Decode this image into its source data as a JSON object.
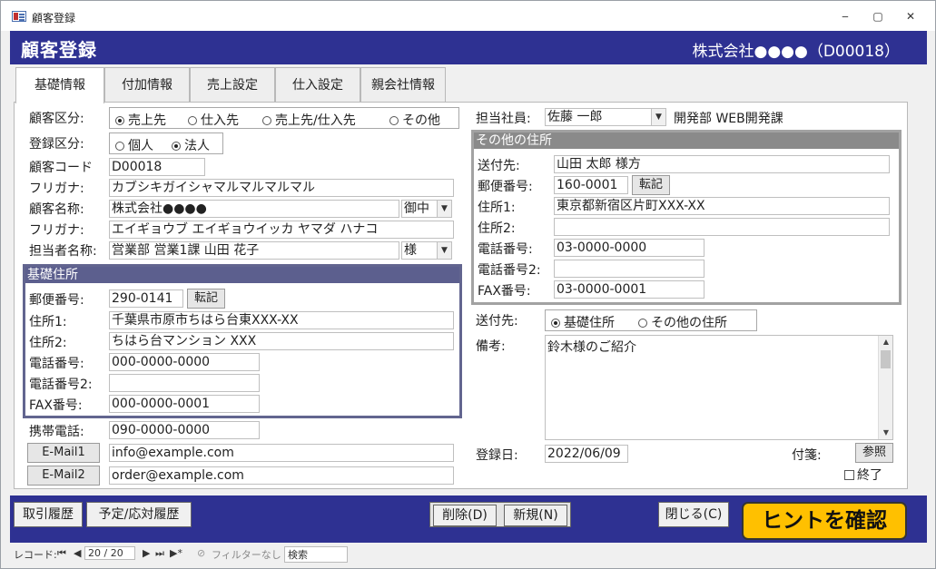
{
  "window": {
    "title": "顧客登録",
    "min": "‒",
    "max": "▢",
    "close": "✕"
  },
  "header": {
    "title": "顧客登録",
    "company": "株式会社●●●●（D00018）"
  },
  "tabs": [
    "基礎情報",
    "付加情報",
    "売上設定",
    "仕入設定",
    "親会社情報"
  ],
  "left": {
    "customer_type": {
      "label": "顧客区分:",
      "options": [
        "売上先",
        "仕入先",
        "売上先/仕入先",
        "その他"
      ],
      "selected": "売上先"
    },
    "reg_type": {
      "label": "登録区分:",
      "options": [
        "個人",
        "法人"
      ],
      "selected": "法人"
    },
    "customer_code": {
      "label": "顧客コード",
      "value": "D00018"
    },
    "furigana1": {
      "label": "フリガナ:",
      "value": "カブシキガイシャマルマルマルマル"
    },
    "customer_name": {
      "label": "顧客名称:",
      "value": "株式会社●●●●",
      "honorific": "御中"
    },
    "furigana2": {
      "label": "フリガナ:",
      "value": "エイギョウブ エイギョウイッカ ヤマダ ハナコ"
    },
    "contact_name": {
      "label": "担当者名称:",
      "value": "営業部 営業1課 山田 花子",
      "honorific": "様"
    },
    "basic_address": {
      "title": "基礎住所",
      "zip_label": "郵便番号:",
      "zip": "290-0141",
      "transfer": "転記",
      "addr1_label": "住所1:",
      "addr1": "千葉県市原市ちはら台東XXX-XX",
      "addr2_label": "住所2:",
      "addr2": "ちはら台マンション XXX",
      "tel_label": "電話番号:",
      "tel": "000-0000-0000",
      "tel2_label": "電話番号2:",
      "tel2": "",
      "fax_label": "FAX番号:",
      "fax": "000-0000-0001"
    },
    "mobile": {
      "label": "携帯電話:",
      "value": "090-0000-0000"
    },
    "email1": {
      "button": "E-Mail1",
      "value": "info@example.com"
    },
    "email2": {
      "button": "E-Mail2",
      "value": "order@example.com"
    }
  },
  "right": {
    "staff": {
      "label": "担当社員:",
      "value": "佐藤 一郎",
      "dept": "開発部 WEB開発課"
    },
    "other_address": {
      "title": "その他の住所",
      "dest_label": "送付先:",
      "dest": "山田 太郎 様方",
      "zip_label": "郵便番号:",
      "zip": "160-0001",
      "transfer": "転記",
      "addr1_label": "住所1:",
      "addr1": "東京都新宿区片町XXX-XX",
      "addr2_label": "住所2:",
      "addr2": "",
      "tel_label": "電話番号:",
      "tel": "03-0000-0000",
      "tel2_label": "電話番号2:",
      "tel2": "",
      "fax_label": "FAX番号:",
      "fax": "03-0000-0001"
    },
    "send_to": {
      "label": "送付先:",
      "options": [
        "基礎住所",
        "その他の住所"
      ],
      "selected": "基礎住所"
    },
    "notes": {
      "label": "備考:",
      "value": "鈴木様のご紹介"
    },
    "reg_date": {
      "label": "登録日:",
      "value": "2022/06/09"
    },
    "sticky": {
      "label": "付箋:",
      "button": "参照"
    },
    "done": {
      "label": "終了",
      "checked": false
    }
  },
  "footer": {
    "history": "取引履歴",
    "schedule": "予定/応対履歴",
    "delete": "削除(D)",
    "new": "新規(N)",
    "close": "閉じる(C)",
    "hint": "ヒントを確認"
  },
  "navbar": {
    "record_label": "レコード:",
    "position": "20 / 20",
    "filter": "フィルターなし",
    "search": "検索"
  }
}
